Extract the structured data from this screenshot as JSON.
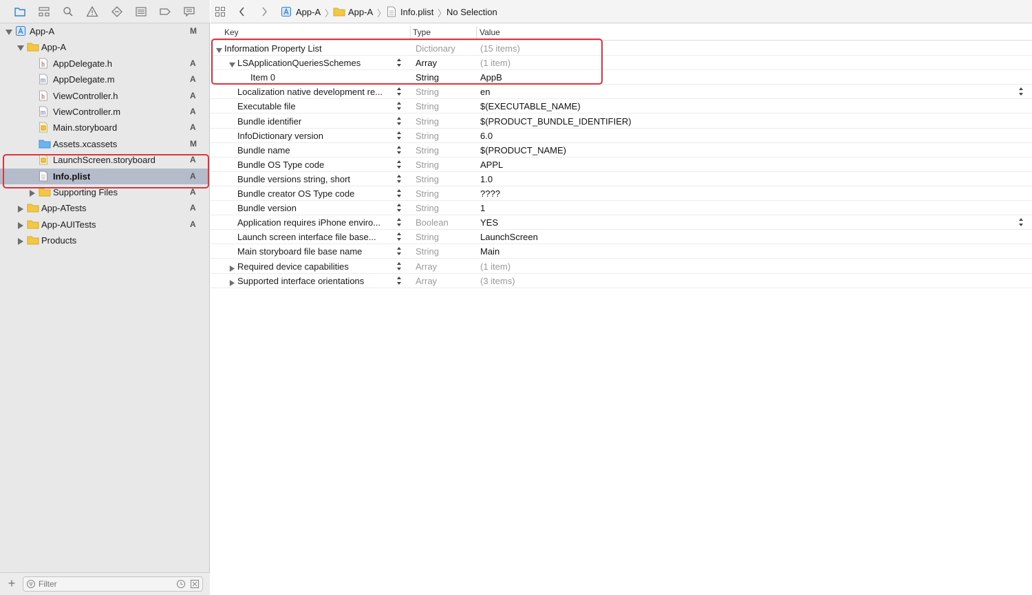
{
  "navigator": {
    "toolbar_icons": [
      "folder-icon",
      "hierarchy-icon",
      "search-icon",
      "warning-icon",
      "test-icon",
      "debug-icon",
      "breakpoint-icon",
      "report-icon"
    ],
    "tree": [
      {
        "label": "App-A",
        "status": "M",
        "icon": "project-icon",
        "indent": 0,
        "expanded": true
      },
      {
        "label": "App-A",
        "status": "",
        "icon": "folder-icon",
        "indent": 1,
        "expanded": true
      },
      {
        "label": "AppDelegate.h",
        "status": "A",
        "icon": "header-file-icon",
        "glyph": "h",
        "indent": 2
      },
      {
        "label": "AppDelegate.m",
        "status": "A",
        "icon": "source-file-icon",
        "glyph": "m",
        "indent": 2
      },
      {
        "label": "ViewController.h",
        "status": "A",
        "icon": "header-file-icon",
        "glyph": "h",
        "indent": 2
      },
      {
        "label": "ViewController.m",
        "status": "A",
        "icon": "source-file-icon",
        "glyph": "m",
        "indent": 2
      },
      {
        "label": "Main.storyboard",
        "status": "A",
        "icon": "storyboard-icon",
        "indent": 2
      },
      {
        "label": "Assets.xcassets",
        "status": "M",
        "icon": "assets-icon",
        "indent": 2
      },
      {
        "label": "LaunchScreen.storyboard",
        "status": "A",
        "icon": "storyboard-icon",
        "indent": 2
      },
      {
        "label": "Info.plist",
        "status": "A",
        "icon": "plist-file-icon",
        "indent": 2,
        "selected": true
      },
      {
        "label": "Supporting Files",
        "status": "A",
        "icon": "folder-icon",
        "indent": 2,
        "collapsed": true
      },
      {
        "label": "App-ATests",
        "status": "A",
        "icon": "folder-icon",
        "indent": 1,
        "collapsed": true
      },
      {
        "label": "App-AUITests",
        "status": "A",
        "icon": "folder-icon",
        "indent": 1,
        "collapsed": true
      },
      {
        "label": "Products",
        "status": "",
        "icon": "folder-icon",
        "indent": 1,
        "collapsed": true
      }
    ],
    "filter_placeholder": "Filter"
  },
  "jumpbar": {
    "crumbs": [
      "App-A",
      "App-A",
      "Info.plist",
      "No Selection"
    ]
  },
  "plist": {
    "columns": {
      "key": "Key",
      "type": "Type",
      "value": "Value"
    },
    "rows": [
      {
        "key": "Information Property List",
        "type": "Dictionary",
        "value": "(15 items)",
        "level": 0,
        "disclosure": "open",
        "type_strong": false,
        "value_muted": true,
        "stepper": false
      },
      {
        "key": "LSApplicationQueriesSchemes",
        "type": "Array",
        "value": "(1 item)",
        "level": 1,
        "disclosure": "open",
        "type_strong": true,
        "value_muted": true,
        "stepper": true
      },
      {
        "key": "Item 0",
        "type": "String",
        "value": "AppB",
        "level": 2,
        "disclosure": "none",
        "type_strong": true,
        "value_muted": false,
        "stepper": false
      },
      {
        "key": "Localization native development re...",
        "type": "String",
        "value": "en",
        "level": 1,
        "disclosure": "none",
        "stepper": true,
        "value_stepper": true
      },
      {
        "key": "Executable file",
        "type": "String",
        "value": "$(EXECUTABLE_NAME)",
        "level": 1,
        "disclosure": "none",
        "stepper": true
      },
      {
        "key": "Bundle identifier",
        "type": "String",
        "value": "$(PRODUCT_BUNDLE_IDENTIFIER)",
        "level": 1,
        "disclosure": "none",
        "stepper": true
      },
      {
        "key": "InfoDictionary version",
        "type": "String",
        "value": "6.0",
        "level": 1,
        "disclosure": "none",
        "stepper": true
      },
      {
        "key": "Bundle name",
        "type": "String",
        "value": "$(PRODUCT_NAME)",
        "level": 1,
        "disclosure": "none",
        "stepper": true
      },
      {
        "key": "Bundle OS Type code",
        "type": "String",
        "value": "APPL",
        "level": 1,
        "disclosure": "none",
        "stepper": true
      },
      {
        "key": "Bundle versions string, short",
        "type": "String",
        "value": "1.0",
        "level": 1,
        "disclosure": "none",
        "stepper": true
      },
      {
        "key": "Bundle creator OS Type code",
        "type": "String",
        "value": "????",
        "level": 1,
        "disclosure": "none",
        "stepper": true
      },
      {
        "key": "Bundle version",
        "type": "String",
        "value": "1",
        "level": 1,
        "disclosure": "none",
        "stepper": true
      },
      {
        "key": "Application requires iPhone enviro...",
        "type": "Boolean",
        "value": "YES",
        "level": 1,
        "disclosure": "none",
        "stepper": true,
        "value_stepper": true
      },
      {
        "key": "Launch screen interface file base...",
        "type": "String",
        "value": "LaunchScreen",
        "level": 1,
        "disclosure": "none",
        "stepper": true
      },
      {
        "key": "Main storyboard file base name",
        "type": "String",
        "value": "Main",
        "level": 1,
        "disclosure": "none",
        "stepper": true
      },
      {
        "key": "Required device capabilities",
        "type": "Array",
        "value": "(1 item)",
        "level": 1,
        "disclosure": "closed",
        "stepper": true,
        "value_muted": true
      },
      {
        "key": "Supported interface orientations",
        "type": "Array",
        "value": "(3 items)",
        "level": 1,
        "disclosure": "closed",
        "stepper": true,
        "value_muted": true
      }
    ]
  },
  "colors": {
    "selection": "#b4bccb",
    "highlight": "#e0313d",
    "folder": "#f2c744",
    "accent": "#2f7fd8"
  }
}
